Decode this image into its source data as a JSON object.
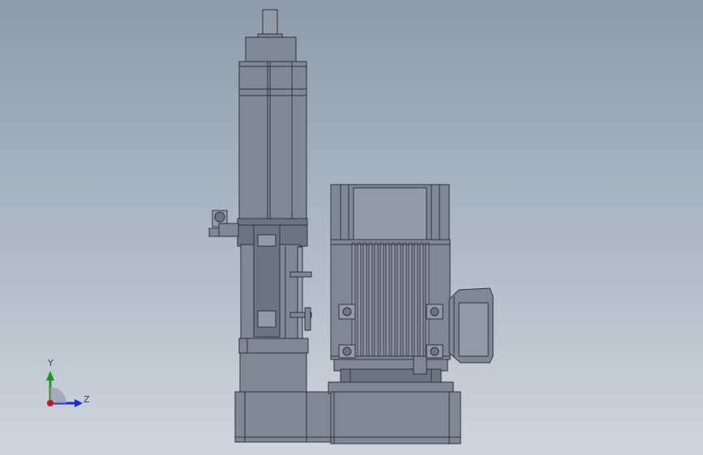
{
  "triad": {
    "y_label": "Y",
    "z_label": "Z",
    "y_color": "#1a9a1a",
    "z_color": "#1b2fd0",
    "x_color": "#c81414"
  },
  "colors": {
    "background_top": "#8e9bab",
    "background_bottom": "#cfd5dc",
    "part_fill": "#7f8894",
    "edge": "#2e3440"
  }
}
